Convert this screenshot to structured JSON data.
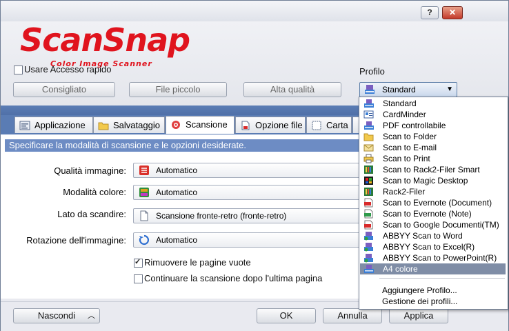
{
  "window": {
    "help_label": "?",
    "close_label": "✕"
  },
  "logo": {
    "brand": "ScanSnap",
    "tagline": "Color Image Scanner"
  },
  "quick_access": {
    "label": "Usare Accesso rapido",
    "checked": false
  },
  "presets": [
    {
      "label": "Consigliato"
    },
    {
      "label": "File piccolo"
    },
    {
      "label": "Alta qualità"
    }
  ],
  "profile": {
    "label": "Profilo",
    "selected": "Standard"
  },
  "tabs": [
    {
      "label": "Applicazione",
      "active": false
    },
    {
      "label": "Salvataggio",
      "active": false
    },
    {
      "label": "Scansione",
      "active": true
    },
    {
      "label": "Opzione file",
      "active": false
    },
    {
      "label": "Carta",
      "active": false
    }
  ],
  "scan_panel": {
    "hint": "Specificare la modalità di scansione e le opzioni desiderate.",
    "fields": [
      {
        "label": "Qualità immagine:",
        "value": "Automatico",
        "icon": "image-quality-icon"
      },
      {
        "label": "Modalità colore:",
        "value": "Automatico",
        "icon": "color-mode-icon"
      },
      {
        "label": "Lato da scandire:",
        "value": "Scansione fronte-retro (fronte-retro)",
        "icon": "duplex-icon"
      },
      {
        "label": "Rotazione dell'immagine:",
        "value": "Automatico",
        "icon": "rotation-icon"
      }
    ],
    "options": [
      {
        "label": "Rimuovere le pagine vuote",
        "checked": true
      },
      {
        "label": "Continuare la scansione dopo l'ultima pagina",
        "checked": false
      }
    ]
  },
  "footer": {
    "hide_label": "Nascondi",
    "ok_label": "OK",
    "cancel_label": "Annulla",
    "apply_label": "Applica"
  },
  "profile_dropdown": {
    "items": [
      {
        "label": "Standard",
        "icon": "scanner-profile-icon"
      },
      {
        "label": "CardMinder",
        "icon": "card-icon"
      },
      {
        "label": "PDF controllabile",
        "icon": "scanner-profile-icon"
      },
      {
        "label": "Scan to Folder",
        "icon": "folder-icon"
      },
      {
        "label": "Scan to E-mail",
        "icon": "mail-icon"
      },
      {
        "label": "Scan to Print",
        "icon": "print-icon"
      },
      {
        "label": "Scan to Rack2-Filer Smart",
        "icon": "rack-icon"
      },
      {
        "label": "Scan to Magic Desktop",
        "icon": "magic-desktop-icon"
      },
      {
        "label": "Rack2-Filer",
        "icon": "rack-icon"
      },
      {
        "label": "Scan to Evernote (Document)",
        "icon": "pdf-icon"
      },
      {
        "label": "Scan to Evernote (Note)",
        "icon": "jpg-icon"
      },
      {
        "label": "Scan to Google Documenti(TM)",
        "icon": "pdf-icon"
      },
      {
        "label": "ABBYY Scan to Word",
        "icon": "abbyy-icon"
      },
      {
        "label": "ABBYY Scan to Excel(R)",
        "icon": "abbyy-icon"
      },
      {
        "label": "ABBYY Scan to PowerPoint(R)",
        "icon": "abbyy-icon"
      },
      {
        "label": "A4 colore",
        "icon": "scanner-profile-icon",
        "selected": true
      }
    ],
    "add_label": "Aggiungere Profilo...",
    "manage_label": "Gestione dei profili..."
  },
  "colors": {
    "brand_red": "#e0141e",
    "tab_band": "#5a7cb4",
    "hint_bg": "#6d8cc4",
    "selected_item": "#7f8da6"
  }
}
